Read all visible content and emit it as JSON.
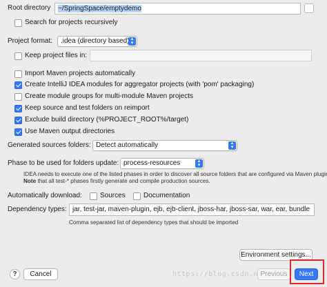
{
  "root_directory": {
    "label": "Root directory",
    "value": "~/SpringSpace/emptydemo"
  },
  "search_recursively": {
    "label": "Search for projects recursively"
  },
  "project_format": {
    "label": "Project format:",
    "value": ".idea (directory based)"
  },
  "keep_project_files": {
    "label": "Keep project files in:"
  },
  "options": [
    {
      "label": "Import Maven projects automatically",
      "checked": false
    },
    {
      "label": "Create IntelliJ IDEA modules for aggregator projects (with 'pom' packaging)",
      "checked": true
    },
    {
      "label": "Create module groups for multi-module Maven projects",
      "checked": false
    },
    {
      "label": "Keep source and test folders on reimport",
      "checked": true
    },
    {
      "label": "Exclude build directory (%PROJECT_ROOT%/target)",
      "checked": true
    },
    {
      "label": "Use Maven output directories",
      "checked": true
    }
  ],
  "generated_sources": {
    "label": "Generated sources folders:",
    "value": "Detect automatically"
  },
  "phase": {
    "label": "Phase to be used for folders update:",
    "value": "process-resources",
    "help_line1": "IDEA needs to execute one of the listed phases in order to discover all source folders that are configured via Maven plugins.",
    "note_bold": "Note",
    "help_line2": " that all test-* phases firstly generate and compile production sources."
  },
  "auto_download": {
    "label": "Automatically download:",
    "sources": "Sources",
    "documentation": "Documentation"
  },
  "dependency_types": {
    "label": "Dependency types:",
    "value": "jar, test-jar, maven-plugin, ejb, ejb-client, jboss-har, jboss-sar, war, ear, bundle",
    "hint": "Comma separated list of dependency types that should be imported"
  },
  "buttons": {
    "environment": "Environment settings...",
    "cancel": "Cancel",
    "previous": "Previous",
    "next": "Next",
    "help": "?"
  },
  "watermark": "https://blog.csdn.net/...",
  "colors": {
    "accent": "#3478f6",
    "highlight": "#e0282a"
  }
}
